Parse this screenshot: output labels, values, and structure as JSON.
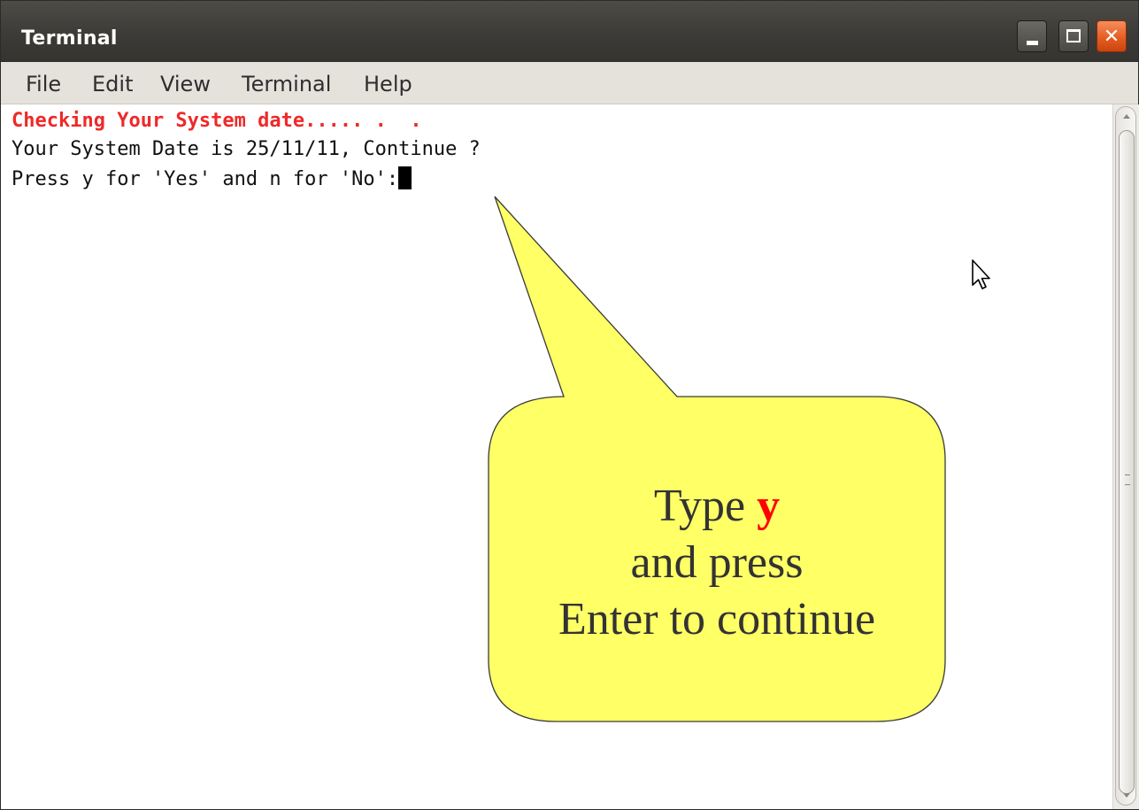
{
  "window": {
    "title": "Terminal"
  },
  "menubar": {
    "items": [
      "File",
      "Edit",
      "View",
      "Terminal",
      "Help"
    ]
  },
  "terminal": {
    "lines": [
      "Checking Your System date..... .  .",
      "Your System Date is 25/11/11, Continue ?",
      "Press y for 'Yes' and n for 'No':"
    ]
  },
  "callout": {
    "prefix": "Type ",
    "key": "y",
    "line2": "and press",
    "line3": "Enter to continue"
  },
  "colors": {
    "callout_fill": "#ffff66",
    "highlight": "#ff0000",
    "prompt_red": "#ef2929"
  },
  "icons": [
    "minimize-icon",
    "maximize-icon",
    "close-icon",
    "mouse-pointer-icon"
  ]
}
